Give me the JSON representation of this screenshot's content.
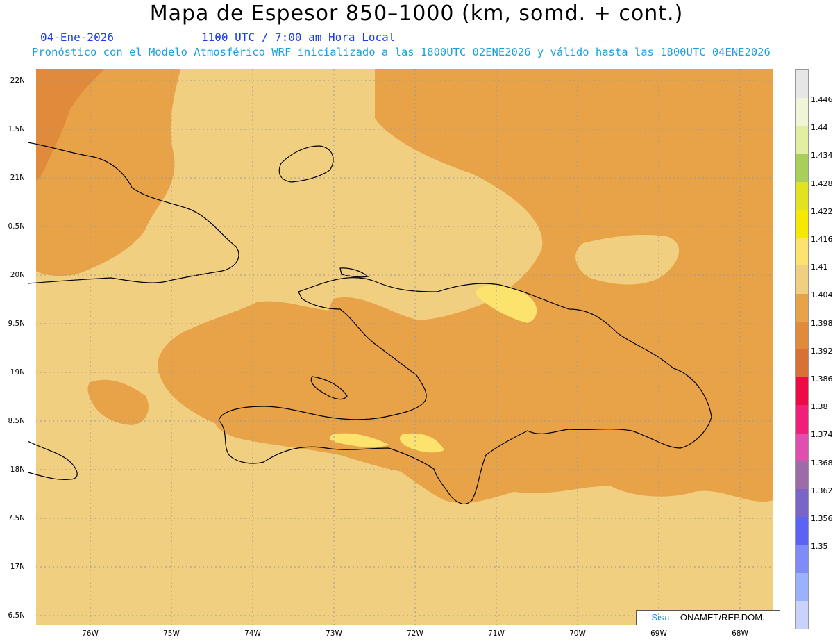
{
  "header": {
    "title": "Mapa de Espesor 850–1000 (km, somd. + cont.)",
    "date": "04-Ene-2026",
    "time": "1100 UTC / 7:00 am Hora Local",
    "forecast": "Pronóstico con el Modelo Atmosférico WRF inicializado a las 1800UTC_02ENE2026 y válido hasta las  1800UTC_04ENE2026"
  },
  "map": {
    "lat_labels": [
      "22N",
      "1.5N",
      "21N",
      "0.5N",
      "20N",
      "9.5N",
      "19N",
      "8.5N",
      "18N",
      "7.5N",
      "17N",
      "6.5N"
    ],
    "lon_labels": [
      "76W",
      "75W",
      "74W",
      "73W",
      "72W",
      "71W",
      "70W",
      "69W",
      "68W"
    ]
  },
  "colorbar": {
    "labels": [
      "1.446",
      "1.44",
      "1.434",
      "1.428",
      "1.422",
      "1.416",
      "1.41",
      "1.404",
      "1.398",
      "1.392",
      "1.386",
      "1.38",
      "1.374",
      "1.368",
      "1.362",
      "1.356",
      "1.35"
    ],
    "colors": [
      "#e6e6e6",
      "#f0f5d8",
      "#e0f0a0",
      "#a8cf5a",
      "#e2e21e",
      "#f6e800",
      "#fce36e",
      "#f1cf80",
      "#e8a348",
      "#e08a3c",
      "#d97135",
      "#ee0a46",
      "#f0207a",
      "#e04fb0",
      "#9d6ca8",
      "#7a64c8",
      "#5a63f5",
      "#7f8cf8",
      "#9ab2fb",
      "#c8d2fb"
    ]
  },
  "credit": {
    "brand": "Sisπ",
    "org": "– ONAMET/REP.DOM."
  }
}
